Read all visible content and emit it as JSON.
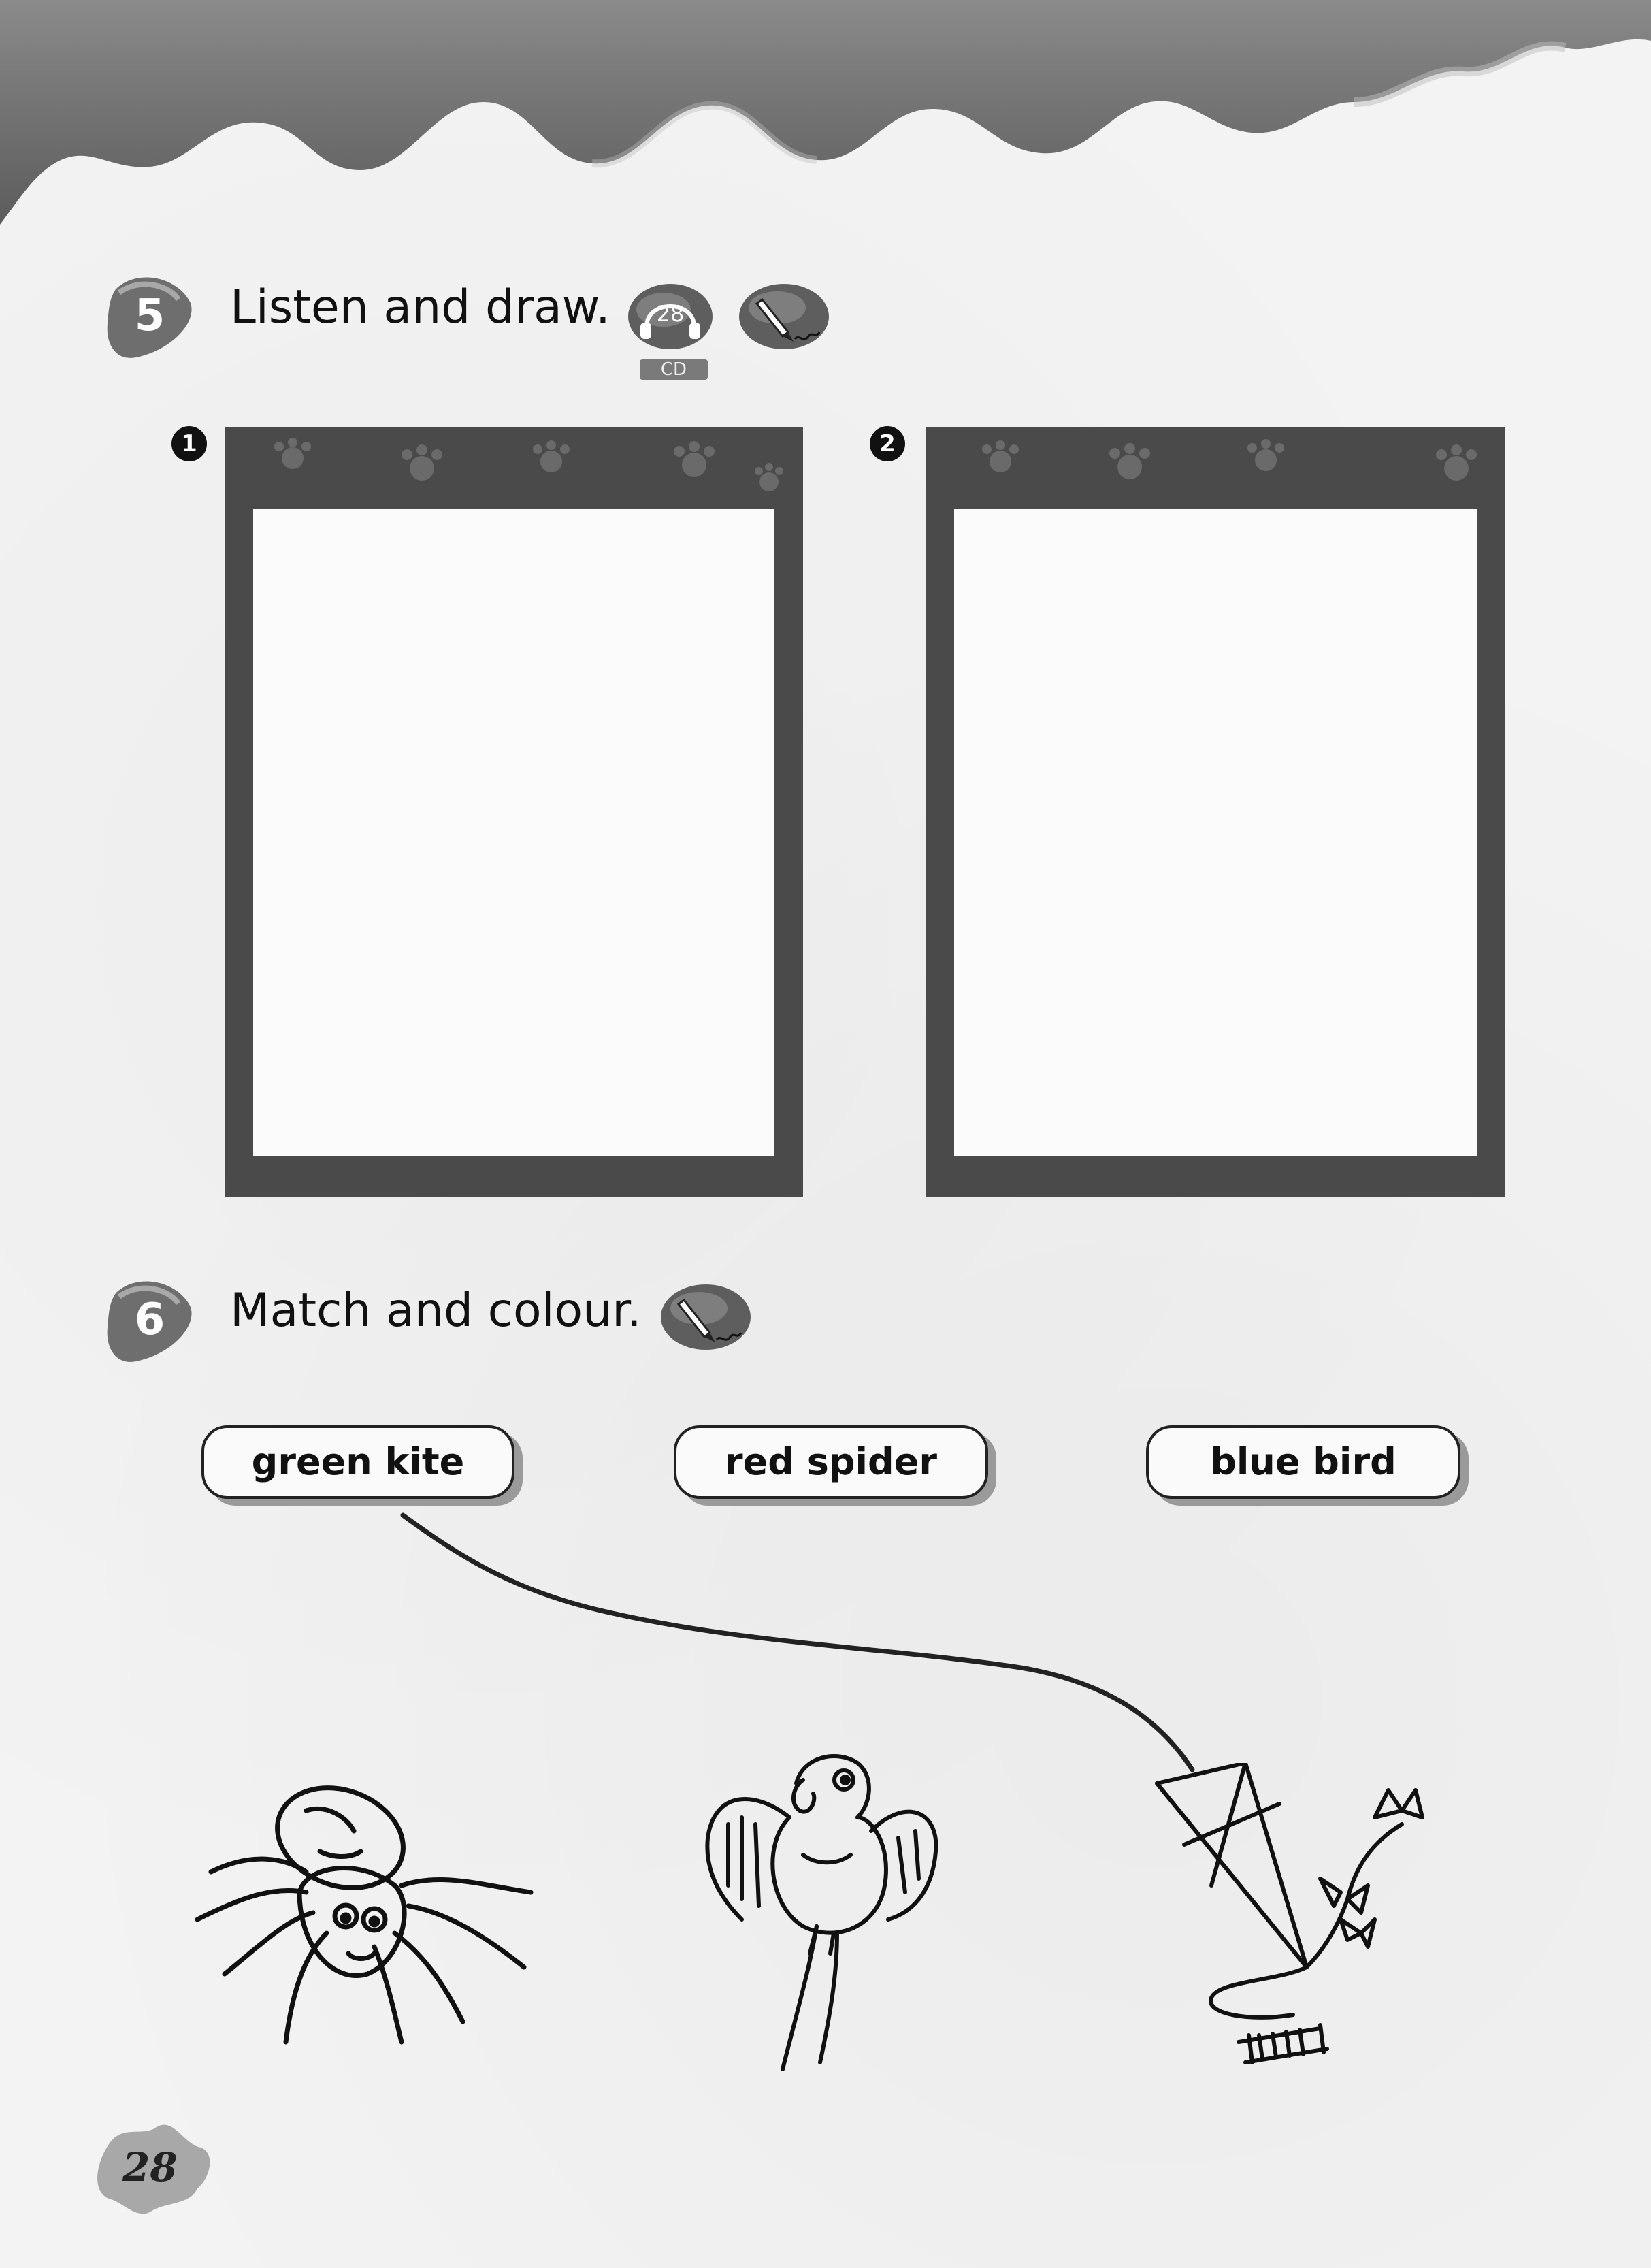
{
  "exercise5": {
    "number": "5",
    "title": "Listen and draw.",
    "track": "28",
    "cd_label": "CD",
    "frames": [
      {
        "number": "1"
      },
      {
        "number": "2"
      }
    ]
  },
  "exercise6": {
    "number": "6",
    "title": "Match and colour.",
    "labels": [
      "green kite",
      "red spider",
      "blue bird"
    ],
    "pictures": [
      "spider",
      "parrot",
      "kite"
    ]
  },
  "icons": {
    "audio": "headphones-icon",
    "draw": "pencil-icon"
  },
  "page_number": "28"
}
